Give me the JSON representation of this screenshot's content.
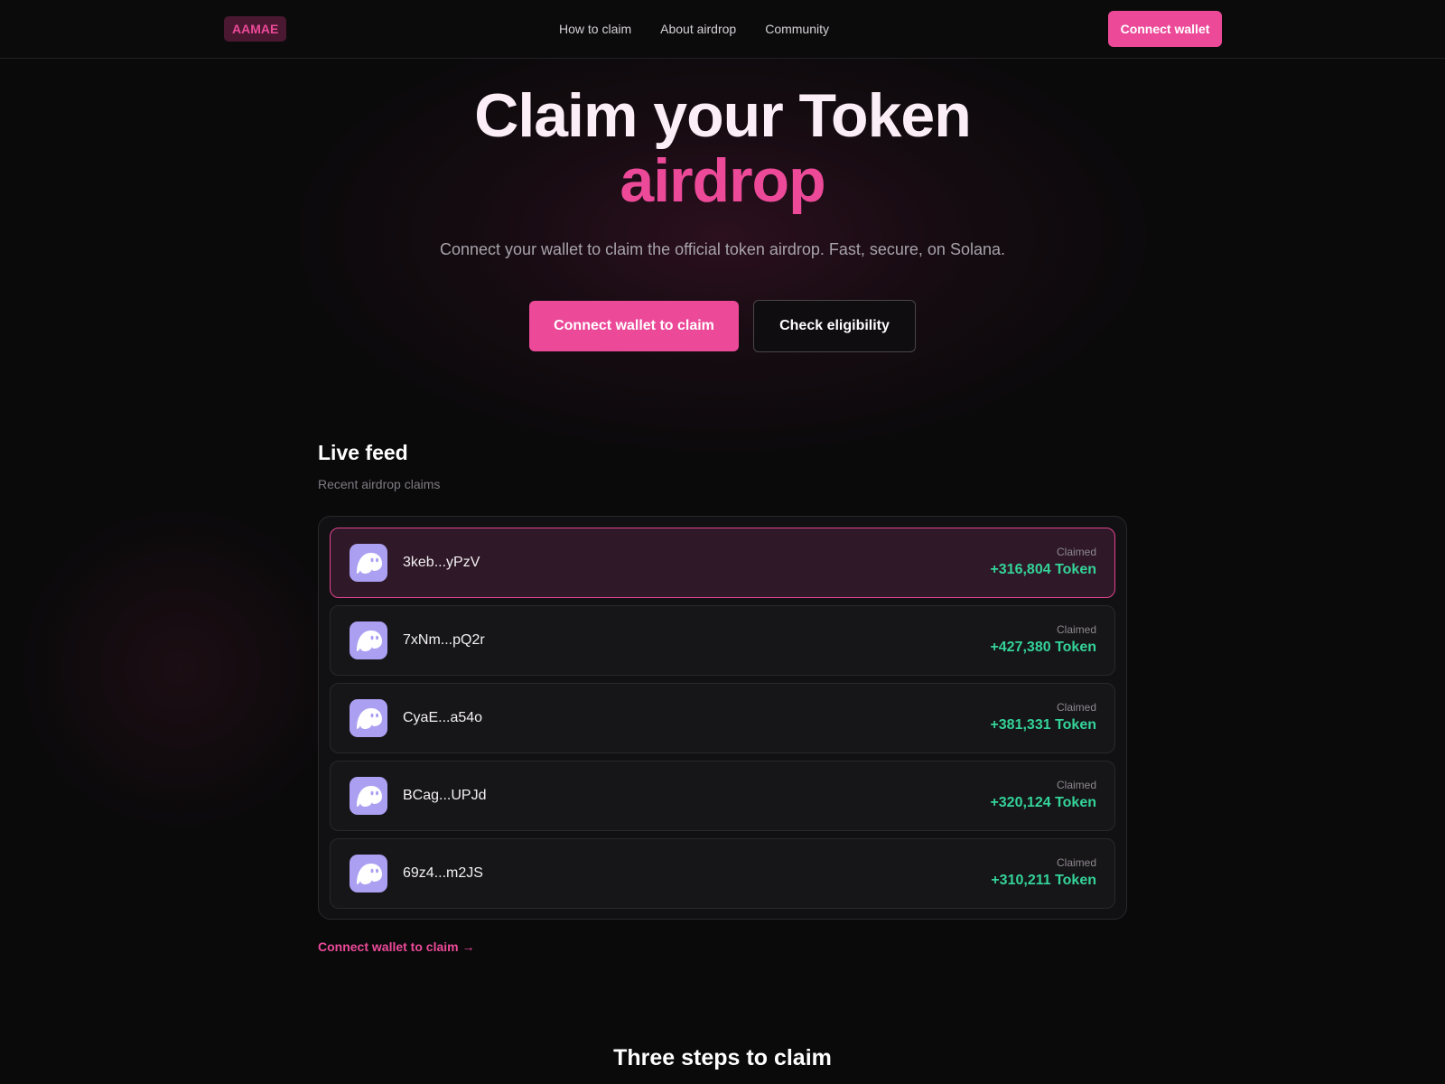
{
  "header": {
    "logo": "AAMAE",
    "nav": [
      "How to claim",
      "About airdrop",
      "Community"
    ],
    "connect_label": "Connect wallet"
  },
  "hero": {
    "title_line1": "Claim your Token",
    "title_line2": "airdrop",
    "subtitle": "Connect your wallet to claim the official token airdrop. Fast, secure, on Solana.",
    "primary_label": "Connect wallet to claim",
    "secondary_label": "Check eligibility"
  },
  "feed": {
    "title": "Live feed",
    "subtitle": "Recent airdrop claims",
    "claimed_label": "Claimed",
    "avatar_icon": "ghost-icon",
    "items": [
      {
        "wallet": "3keb...yPzV",
        "amount": "+316,804 Token",
        "highlighted": true
      },
      {
        "wallet": "7xNm...pQ2r",
        "amount": "+427,380 Token",
        "highlighted": false
      },
      {
        "wallet": "CyaE...a54o",
        "amount": "+381,331 Token",
        "highlighted": false
      },
      {
        "wallet": "BCag...UPJd",
        "amount": "+320,124 Token",
        "highlighted": false
      },
      {
        "wallet": "69z4...m2JS",
        "amount": "+310,211 Token",
        "highlighted": false
      }
    ],
    "link_label": "Connect wallet to claim →"
  },
  "steps": {
    "title": "Three steps to claim"
  },
  "colors": {
    "accent": "#ec4a99",
    "success": "#34d399",
    "avatar_bg": "#ab9ff2",
    "background": "#0b0a0b"
  }
}
